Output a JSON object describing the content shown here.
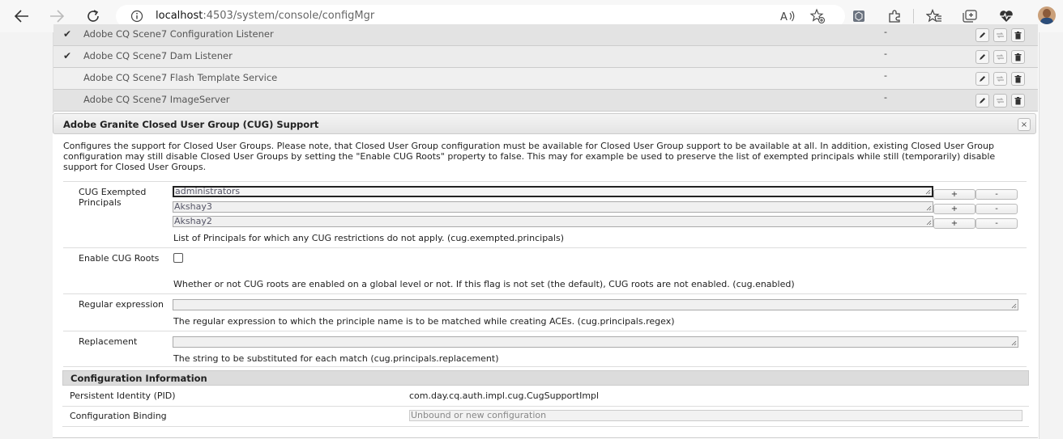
{
  "browser": {
    "url_host": "localhost",
    "url_path": ":4503/system/console/configMgr"
  },
  "list": [
    {
      "name": "Adobe CQ Scene7 Configuration Listener",
      "checked": true,
      "value": "-"
    },
    {
      "name": "Adobe CQ Scene7 Dam Listener",
      "checked": true,
      "value": "-"
    },
    {
      "name": "Adobe CQ Scene7 Flash Template Service",
      "checked": false,
      "value": "-"
    },
    {
      "name": "Adobe CQ Scene7 ImageServer",
      "checked": false,
      "value": "-"
    }
  ],
  "dialog": {
    "title": "Adobe Granite Closed User Group (CUG) Support",
    "close_label": "×",
    "description": "Configures the support for Closed User Groups. Please note, that Closed User Group configuration must be available for Closed User Group support to be available at all. In addition, existing Closed User Group configuration may still disable Closed User Groups by setting the \"Enable CUG Roots\" property to false. This may for example be used to preserve the list of exempted principals while still (temporarily) disable support for Closed User Groups.",
    "exempted": {
      "label": "CUG Exempted Principals",
      "values": [
        "administrators",
        "Akshay3",
        "Akshay2"
      ],
      "add_label": "+",
      "remove_label": "-",
      "help": "List of Principals for which any CUG restrictions do not apply. (cug.exempted.principals)"
    },
    "enable_roots": {
      "label": "Enable CUG Roots",
      "checked": false,
      "help": "Whether or not CUG roots are enabled on a global level or not. If this flag is not set (the default), CUG roots are not enabled. (cug.enabled)"
    },
    "regex": {
      "label": "Regular expression",
      "value": "",
      "help": "The regular expression to which the principle name is to be matched while creating ACEs. (cug.principals.regex)"
    },
    "replacement": {
      "label": "Replacement",
      "value": "",
      "help": "The string to be substituted for each match (cug.principals.replacement)"
    },
    "config_info": {
      "title": "Configuration Information",
      "pid_label": "Persistent Identity (PID)",
      "pid_value": "com.day.cq.auth.impl.cug.CugSupportImpl",
      "binding_label": "Configuration Binding",
      "binding_value": "Unbound or new configuration"
    }
  }
}
